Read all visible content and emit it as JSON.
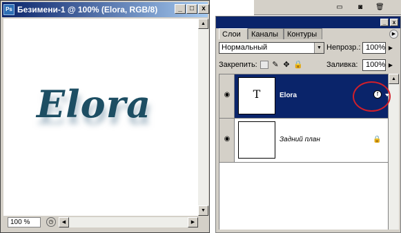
{
  "document": {
    "title": "Безимени-1 @ 100% (Elora, RGB/8)",
    "canvas_text": "Elora",
    "zoom": "100 %",
    "window_buttons": [
      "_",
      "□",
      "x"
    ]
  },
  "layers_panel": {
    "tabs": [
      "Слои",
      "Каналы",
      "Контуры"
    ],
    "blend_mode": "Нормальный",
    "opacity_label": "Непрозр.:",
    "opacity_value": "100%",
    "lock_label": "Закрепить:",
    "fill_label": "Заливка:",
    "fill_value": "100%",
    "layers": [
      {
        "name": "Elora",
        "thumb_text": "T",
        "selected": true,
        "has_effects": true
      },
      {
        "name": "Задний план",
        "thumb_text": "",
        "selected": false,
        "locked": true
      }
    ]
  },
  "colors": {
    "title_bar": "#0a246a",
    "selection": "#0a246a",
    "text_layer_color": "#1d4e63",
    "highlight_circle": "#d21f2a"
  },
  "icons": [
    "photoshop-icon",
    "eye-icon",
    "lock-icon",
    "brush-icon",
    "move-icon",
    "layer-effects-icon",
    "panel-menu-icon"
  ]
}
